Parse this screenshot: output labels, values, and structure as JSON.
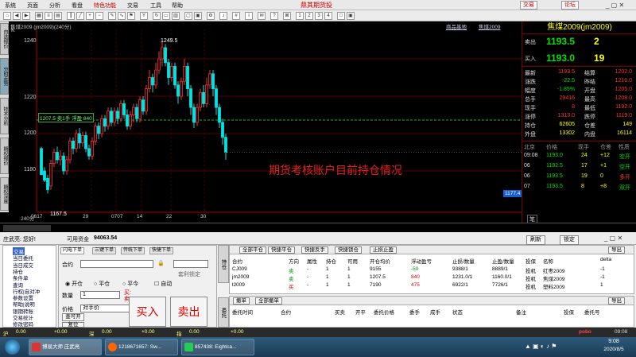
{
  "app_title": "鼎其期货投",
  "menu": [
    "系统",
    "页面",
    "分析",
    "看盘",
    "特色功能",
    "交易",
    "工具",
    "帮助"
  ],
  "top_buttons": {
    "trade": "交易",
    "forum": "论坛"
  },
  "left_tabs": [
    "自选报价",
    "分时走势",
    "技术分析",
    "期权报价",
    "期权深度"
  ],
  "chart": {
    "contract_info": "焦煤2009 (jm2009)(240分)",
    "top_links": [
      "商品基地",
      "焦煤2009"
    ],
    "y_ticks": [
      "1240",
      "1220",
      "1200",
      "1180"
    ],
    "x_ticks": [
      "240分",
      "0617",
      "29",
      "0707",
      "14",
      "22",
      "30"
    ],
    "k_label": "K",
    "high_label": "1249.5",
    "low_label": "1167.5",
    "position_line_label": "1207.5 卖1手 浮盈 840",
    "current_price_tag": "1177.4",
    "overlay_text": "期货考核账户目前持仓情况"
  },
  "quote": {
    "title": "焦煤2009(jm2009)",
    "sell_label": "卖出",
    "sell_price": "1193.5",
    "sell_vol": "2",
    "buy_label": "买入",
    "buy_price": "1193.0",
    "buy_vol": "19",
    "rows": [
      [
        "最新",
        "1193.5",
        "结算",
        "1202.0"
      ],
      [
        "涨跌",
        "-22.5",
        "昨结",
        "1216.0"
      ],
      [
        "幅度",
        "-1.85%",
        "开盘",
        "1205.0"
      ],
      [
        "总手",
        "29416",
        "最高",
        "1208.0"
      ],
      [
        "现手",
        "8",
        "最低",
        "1192.0"
      ],
      [
        "涨停",
        "1313.0",
        "跌停",
        "1119.0"
      ],
      [
        "持仓",
        "62605",
        "仓差",
        "149"
      ],
      [
        "外盘",
        "13302",
        "内盘",
        "16114"
      ]
    ],
    "tick_header": [
      "北京",
      "价格",
      "现手",
      "仓差",
      "性质"
    ],
    "ticks": [
      [
        "09:08",
        "1193.0",
        "24",
        "+12",
        "空开"
      ],
      [
        "06",
        "1192.5",
        "17",
        "+1",
        "空开"
      ],
      [
        "06",
        "1193.5",
        "19",
        "0",
        "多开"
      ],
      [
        "07",
        "1193.5",
        "8",
        "+8",
        "双开"
      ]
    ],
    "bottom_tab": "笔"
  },
  "account": {
    "greeting": "庄武亮: 您好!",
    "funds_label": "可用资金",
    "funds_value": "94063.54",
    "buttons": [
      "刷新",
      "锁定"
    ]
  },
  "tree": [
    "交易",
    "当日委托",
    "当日成交",
    "持仓",
    "条件单",
    "查询",
    "行权|自对冲",
    "参数设置",
    "帮助|说明",
    "银期转账",
    "交易统计",
    "修改密码"
  ],
  "order": {
    "tabs": [
      "闪电下单",
      "三键下单",
      "传统下单",
      "快捷下单"
    ],
    "contract_label": "合约",
    "options": [
      "开仓",
      "平仓",
      "平今"
    ],
    "auto_label": "自动",
    "qty_label": "数量",
    "qty_value": "1",
    "price_label": "价格",
    "price_value": "对手价",
    "stoploss_label": "套利锁定",
    "buy_hint": "买:",
    "sell_hint": "卖:",
    "side_buttons": [
      "查可开",
      "复位",
      "条件",
      "询价"
    ],
    "buy_btn": "买入",
    "sell_btn": "卖出"
  },
  "positions": {
    "strip_label": "持仓",
    "buttons": [
      "全部平仓",
      "快捷平仓",
      "快捷反手",
      "快捷锁仓",
      "止损止盈"
    ],
    "export": "导出",
    "headers": [
      "合约",
      "方向",
      "属性",
      "持仓",
      "可用",
      "开仓均价",
      "浮动盈亏",
      "止损/数量",
      "止盈/数量",
      "投保",
      "名称",
      "delta"
    ],
    "rows": [
      [
        "CJ009",
        "卖",
        "-",
        "1",
        "1",
        "9155",
        "-50",
        "9388/1",
        "8889/1",
        "投机",
        "红枣2009",
        "-1"
      ],
      [
        "jm2009",
        "卖",
        "-",
        "1",
        "1",
        "1207.5",
        "840",
        "1231.0/1",
        "1160.0/1",
        "投机",
        "焦煤2009",
        "-1"
      ],
      [
        "l2009",
        "买",
        "-",
        "1",
        "1",
        "7190",
        "475",
        "6922/1",
        "7726/1",
        "投机",
        "塑料2009",
        "1"
      ]
    ]
  },
  "orders": {
    "strip_label": "委托",
    "buttons": [
      "撤单",
      "全部撤单"
    ],
    "export": "导出",
    "headers": [
      "委托时间",
      "合约",
      "买卖",
      "开平",
      "委托价格",
      "委手",
      "成手",
      "状态",
      "备注",
      "投保",
      "委托号"
    ]
  },
  "status_bar": {
    "items": [
      "沪",
      "0.00",
      "+0.00",
      "深",
      "0.00",
      "+0.00",
      "指",
      "0.00",
      "+0.00"
    ],
    "brand": "pobo",
    "time": "09:08"
  },
  "taskbar": {
    "tasks": [
      "博易大师 庄武亮",
      "1218671657: Sw...",
      "857438: Eightca..."
    ],
    "clock_time": "9:08",
    "clock_date": "2020/8/5"
  },
  "colors": {
    "up": "#ff3030",
    "down": "#00e5e5",
    "accent": "#ffff00",
    "grid": "#5a0000"
  }
}
